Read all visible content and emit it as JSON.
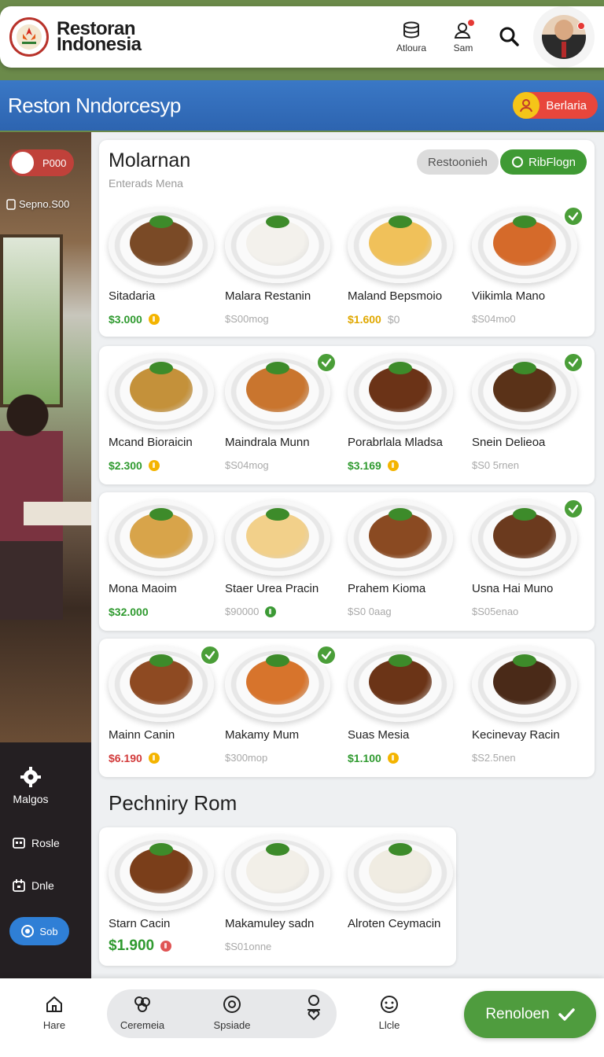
{
  "header": {
    "brand_line1": "Restoran",
    "brand_line2": "Indonesia",
    "btn1_label": "Atloura",
    "btn2_label": "Sam"
  },
  "banner": {
    "title": "Reston Nndorcesyp",
    "pill_label": "Berlaria"
  },
  "sidebar": {
    "tag_label": "P000",
    "sub_label": "Sepno.S00",
    "menu": [
      {
        "label": "Malgos",
        "icon": "gear-icon"
      },
      {
        "label": "Rosle",
        "icon": "grid-icon"
      },
      {
        "label": "Dnle",
        "icon": "calendar-icon"
      }
    ],
    "pill_label": "Sob"
  },
  "section1": {
    "title": "Molarnan",
    "subtitle": "Enterads Mena",
    "chip_gray": "Restoonieh",
    "chip_green": "RibFlogn",
    "dishes": [
      {
        "name": "Sitadaria",
        "price": "$3.000",
        "extra": "",
        "price_color": "#2f9a2f",
        "coin": "#f4b400",
        "muted": false,
        "check": false,
        "food": "#7a4a26"
      },
      {
        "name": "Malara Restanin",
        "price": "$S00mog",
        "extra": "",
        "price_color": "#a9a9a9",
        "coin": "",
        "muted": true,
        "check": false,
        "food": "#f3f1ec"
      },
      {
        "name": "Maland Bepsmoio",
        "price": "$1.600",
        "extra": "$0",
        "price_color": "#e0a800",
        "coin": "",
        "muted": false,
        "check": false,
        "food": "#f0c15a"
      },
      {
        "name": "Viikimla Mano",
        "price": "$S04mo0",
        "extra": "",
        "price_color": "#a9a9a9",
        "coin": "",
        "muted": true,
        "check": true,
        "food": "#d56a2a"
      },
      {
        "name": "Mcand Bioraicin",
        "price": "$2.300",
        "extra": "",
        "price_color": "#2f9a2f",
        "coin": "#f4b400",
        "muted": false,
        "check": false,
        "food": "#c4913a"
      },
      {
        "name": "Maindrala Munn",
        "price": "$S04mog",
        "extra": "",
        "price_color": "#a9a9a9",
        "coin": "",
        "muted": true,
        "check": true,
        "food": "#c9752e"
      },
      {
        "name": "Porabrlala Mladsa",
        "price": "$3.169",
        "extra": "",
        "price_color": "#2f9a2f",
        "coin": "#f4b400",
        "muted": false,
        "check": false,
        "food": "#6b3317"
      },
      {
        "name": "Snein Delieoa",
        "price": "$S0 5rnen",
        "extra": "",
        "price_color": "#a9a9a9",
        "coin": "",
        "muted": true,
        "check": true,
        "food": "#5a3218"
      },
      {
        "name": "Mona Maoim",
        "price": "$32.000",
        "extra": "",
        "price_color": "#2f9a2f",
        "coin": "",
        "muted": false,
        "check": false,
        "food": "#d8a44a"
      },
      {
        "name": "Staer Urea Pracin",
        "price": "$90000",
        "extra": "",
        "price_color": "#a9a9a9",
        "coin": "#3c9a35",
        "muted": true,
        "check": false,
        "food": "#f2d08a"
      },
      {
        "name": "Prahem Kioma",
        "price": "$S0 0aag",
        "extra": "",
        "price_color": "#a9a9a9",
        "coin": "",
        "muted": true,
        "check": false,
        "food": "#8a4a22"
      },
      {
        "name": "Usna Hai Muno",
        "price": "$S05enao",
        "extra": "",
        "price_color": "#a9a9a9",
        "coin": "",
        "muted": true,
        "check": true,
        "food": "#6b3a1e"
      },
      {
        "name": "Mainn Canin",
        "price": "$6.190",
        "extra": "",
        "price_color": "#d23a3a",
        "coin": "#f4b400",
        "muted": false,
        "check": true,
        "food": "#8e4a22"
      },
      {
        "name": "Makamy Mum",
        "price": "$300mop",
        "extra": "",
        "price_color": "#a9a9a9",
        "coin": "",
        "muted": true,
        "check": true,
        "food": "#d7742c"
      },
      {
        "name": "Suas Mesia",
        "price": "$1.100",
        "extra": "",
        "price_color": "#2f9a2f",
        "coin": "#f4b400",
        "muted": false,
        "check": false,
        "food": "#6b3417"
      },
      {
        "name": "Kecinevay Racin",
        "price": "$S2.5nen",
        "extra": "",
        "price_color": "#a9a9a9",
        "coin": "",
        "muted": true,
        "check": false,
        "food": "#4a2a18"
      }
    ]
  },
  "section2": {
    "title": "Pechniry Rom",
    "dishes": [
      {
        "name": "Starn Cacin",
        "price": "$1.900",
        "price_color": "#2f9a2f",
        "coin": "#e05454",
        "muted": false,
        "big": true,
        "food": "#7a3e1a"
      },
      {
        "name": "Makamuley sadn",
        "price": "$S01onne",
        "price_color": "#a9a9a9",
        "coin": "",
        "muted": true,
        "big": false,
        "food": "#f2efe8"
      },
      {
        "name": "Alroten Ceymacin",
        "price": "",
        "price_color": "#a9a9a9",
        "coin": "",
        "muted": true,
        "big": false,
        "food": "#f0ece2"
      }
    ]
  },
  "bottom_nav": {
    "home": "Hare",
    "item2": "Ceremeia",
    "item3": "Spsiade",
    "item5": "Llcle",
    "cta": "Renoloen"
  }
}
